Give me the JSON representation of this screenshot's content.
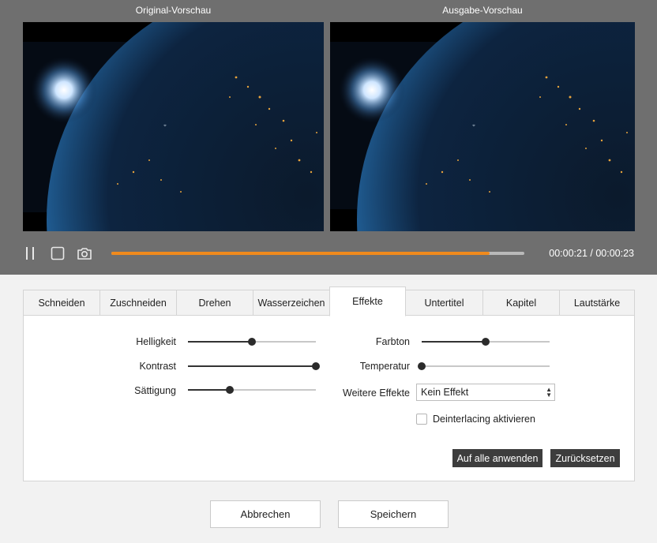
{
  "previews": {
    "original_label": "Original-Vorschau",
    "output_label": "Ausgabe-Vorschau"
  },
  "player": {
    "pause_icon": "pause-icon",
    "stop_icon": "stop-icon",
    "snapshot_icon": "camera-icon",
    "progress_percent": 91.5,
    "time": "00:00:21 / 00:00:23",
    "accent_color": "#f08a1c"
  },
  "tabs": [
    {
      "label": "Schneiden"
    },
    {
      "label": "Zuschneiden"
    },
    {
      "label": "Drehen"
    },
    {
      "label": "Wasserzeichen"
    },
    {
      "label": "Effekte",
      "active": true
    },
    {
      "label": "Untertitel"
    },
    {
      "label": "Kapitel"
    },
    {
      "label": "Lautstärke"
    }
  ],
  "effects": {
    "brightness": {
      "label": "Helligkeit",
      "value_percent": 50
    },
    "contrast": {
      "label": "Kontrast",
      "value_percent": 100
    },
    "saturation": {
      "label": "Sättigung",
      "value_percent": 33
    },
    "hue": {
      "label": "Farbton",
      "value_percent": 50
    },
    "temperature": {
      "label": "Temperatur",
      "value_percent": 0
    },
    "more_effects": {
      "label": "Weitere Effekte",
      "selected": "Kein Effekt"
    },
    "deinterlace": {
      "label": "Deinterlacing aktivieren",
      "checked": false
    },
    "apply_all_label": "Auf alle anwenden",
    "reset_label": "Zurücksetzen"
  },
  "footer": {
    "cancel_label": "Abbrechen",
    "save_label": "Speichern"
  }
}
